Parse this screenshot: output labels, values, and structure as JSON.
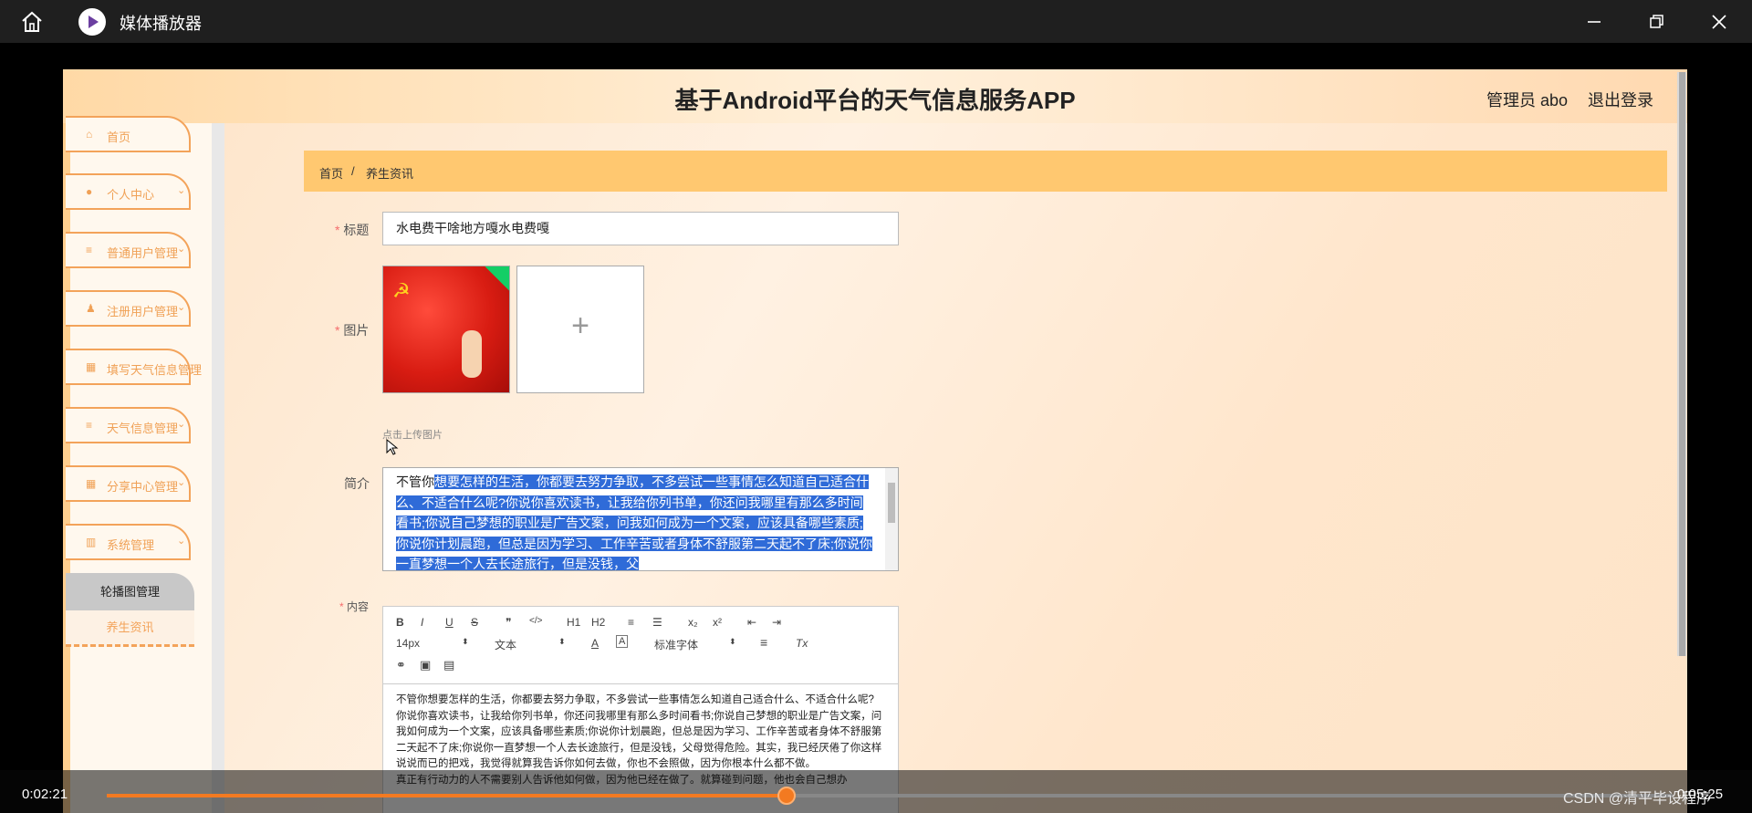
{
  "window": {
    "title": "媒体播放器",
    "minimize_icon": "minimize-icon",
    "restore_icon": "restore-icon",
    "close_icon": "close-icon"
  },
  "site": {
    "title": "基于Android平台的天气信息服务APP",
    "admin_label": "管理员 abo",
    "logout_label": "退出登录"
  },
  "sidebar": {
    "items": [
      {
        "label": "首页",
        "icon": "home-icon"
      },
      {
        "label": "个人中心",
        "icon": "person-icon"
      },
      {
        "label": "普通用户管理",
        "icon": "list-icon"
      },
      {
        "label": "注册用户管理",
        "icon": "user-icon"
      },
      {
        "label": "填写天气信息管理",
        "icon": "grid-icon"
      },
      {
        "label": "天气信息管理",
        "icon": "list-icon"
      },
      {
        "label": "分享中心管理",
        "icon": "grid-icon"
      },
      {
        "label": "系统管理",
        "icon": "book-icon"
      }
    ],
    "sub_items": [
      {
        "label": "轮播图管理"
      },
      {
        "label": "养生资讯"
      }
    ]
  },
  "breadcrumb": {
    "home": "首页",
    "separator": "/",
    "current": "养生资讯"
  },
  "form": {
    "title_label": "标题",
    "title_value": "水电费干啥地方嘎水电费嘎",
    "image_label": "图片",
    "upload_plus": "+",
    "upload_hint": "点击上传图片",
    "summary_label": "简介",
    "summary_unselected": "不管你",
    "summary_selected": "想要怎样的生活，你都要去努力争取，不多尝试一些事情怎么知道自己适合什么、不适合什么呢?你说你喜欢读书，让我给你列书单，你还问我哪里有那么多时间看书;你说自己梦想的职业是广告文案，问我如何成为一个文案，应该具备哪些素质;你说你计划晨跑，但总是因为学习、工作辛苦或者身体不舒服第二天起不了床;你说你一直梦想一个人去长途旅行，但是没钱，父",
    "content_label": "内容",
    "required_mark": "*"
  },
  "editor": {
    "buttons": [
      "B",
      "I",
      "U",
      "S",
      "❞",
      "</>",
      "H1",
      "H2",
      "≡",
      "☰",
      "x₂",
      "x²",
      "⇤",
      "⇥"
    ],
    "size_value": "14px",
    "block_value": "文本",
    "font_value": "标准字体",
    "text_color": "A",
    "clear_format": "Tx",
    "content": "不管你想要怎样的生活，你都要去努力争取，不多尝试一些事情怎么知道自己适合什么、不适合什么呢?\n你说你喜欢读书，让我给你列书单，你还问我哪里有那么多时间看书;你说自己梦想的职业是广告文案，问我如何成为一个文案，应该具备哪些素质;你说你计划晨跑，但总是因为学习、工作辛苦或者身体不舒服第二天起不了床;你说你一直梦想一个人去长途旅行，但是没钱，父母觉得危险。其实，我已经厌倦了你这样说说而已的把戏，我觉得就算我告诉你如何去做，你也不会照做，因为你根本什么都不做。\n真正有行动力的人不需要别人告诉他如何做，因为他已经在做了。就算碰到问题，他也会自己想办"
  },
  "player": {
    "current_time": "0:02:21",
    "progress": 0.434,
    "watermark": "CSDN @清平毕设程序",
    "total_time": "0:05:25"
  },
  "colors": {
    "accent": "#f37a21",
    "sidebar_border": "#f3a35a",
    "breadcrumb_bg": "#ffc870",
    "selection": "#2f6bd8"
  }
}
